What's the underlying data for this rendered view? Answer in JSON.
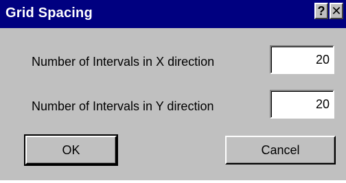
{
  "window": {
    "title": "Grid Spacing",
    "help_label": "?",
    "close_label": "✕"
  },
  "fields": {
    "x_label": "Number of Intervals in X direction",
    "x_value": "20",
    "y_label": "Number of Intervals in Y direction",
    "y_value": "20"
  },
  "buttons": {
    "ok_label": "OK",
    "cancel_label": "Cancel"
  },
  "colors": {
    "titlebar": "#000080",
    "dialog_face": "#c0c0c0"
  }
}
